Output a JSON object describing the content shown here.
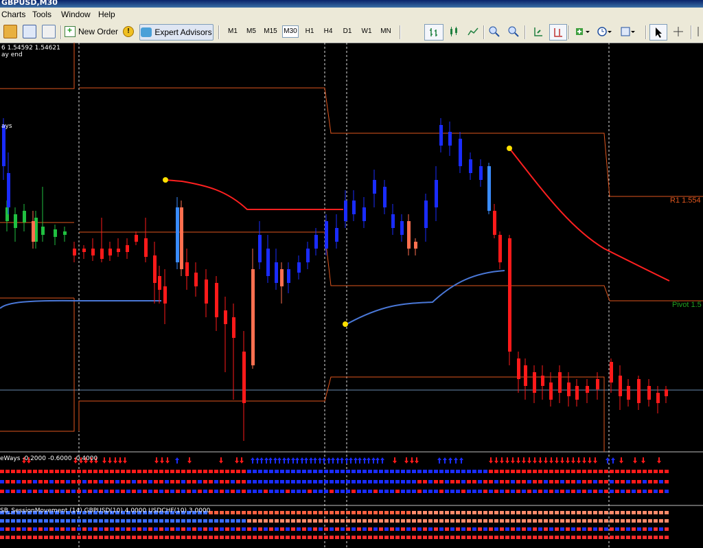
{
  "window": {
    "title": "GBPUSD,M30"
  },
  "menu": {
    "items": [
      "Charts",
      "Tools",
      "Window",
      "Help"
    ]
  },
  "toolbar": {
    "new_order": "New Order",
    "expert_advisors": "Expert Advisors",
    "timeframes": [
      "M1",
      "M5",
      "M15",
      "M30",
      "H1",
      "H4",
      "D1",
      "W1",
      "MN"
    ],
    "active_timeframe": "M30"
  },
  "chart": {
    "header_line1": "6  1.54592 1.54621",
    "header_line2": "ay end",
    "side_label": "ays",
    "r1_label": "R1 1.554",
    "pivot_label": "Pivot 1.5",
    "colors": {
      "bull": "#1a2cff",
      "bear": "#ff1a1a",
      "pivot": "#e0561e",
      "ma": "#4a78d8",
      "red_line": "#ff2020"
    }
  },
  "indicators": {
    "panel1_label": "eWays -0.2000 -0.6000 -0.4000",
    "panel2_label": "SB_SessionMovement (14) GBPUSD(10) 4.0000  USDCHF(10) 3.0000"
  }
}
